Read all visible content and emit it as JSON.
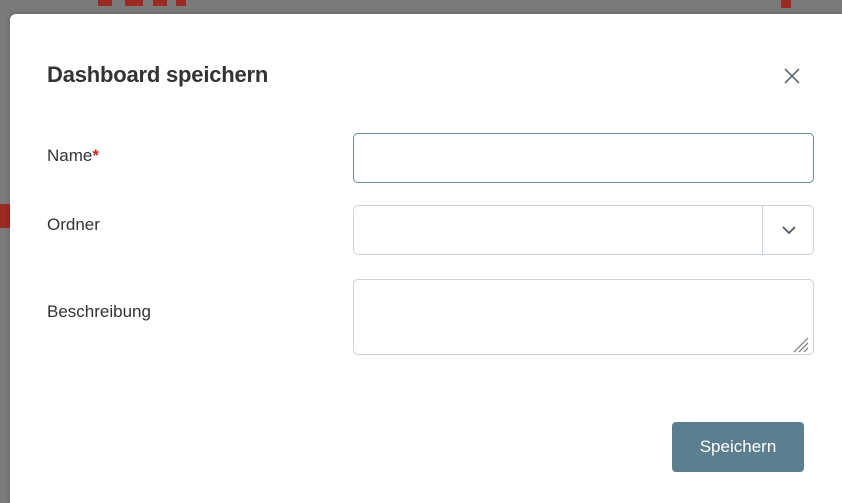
{
  "dialog": {
    "title": "Dashboard speichern",
    "close_icon": "close-icon"
  },
  "form": {
    "name": {
      "label": "Name",
      "required_marker": "*",
      "value": ""
    },
    "folder": {
      "label": "Ordner",
      "selected_value": "",
      "icon": "chevron-down-icon"
    },
    "description": {
      "label": "Beschreibung",
      "value": ""
    }
  },
  "actions": {
    "save_label": "Speichern"
  },
  "colors": {
    "primary_button": "#5b7f8e",
    "focused_border": "#6d8797",
    "required": "#c62828",
    "backdrop": "#7a7a7a"
  }
}
